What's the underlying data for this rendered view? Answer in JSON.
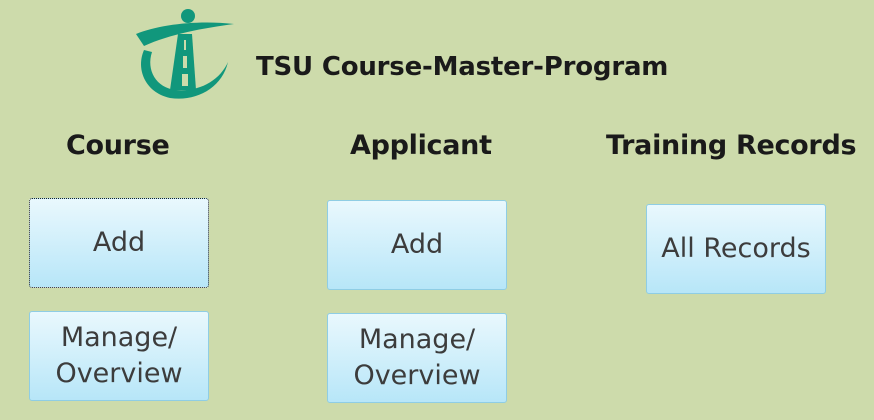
{
  "app": {
    "title": "TSU Course-Master-Program",
    "logo_icon": "tsu-logo-icon",
    "colors": {
      "background": "#cddbab",
      "logo_green": "#11977c",
      "button_top": "#e9f8fd",
      "button_bottom": "#b7e6f8",
      "button_border": "#8fcde4"
    }
  },
  "sections": {
    "course": {
      "heading": "Course",
      "add_label": "Add",
      "manage_label": "Manage/\nOverview"
    },
    "applicant": {
      "heading": "Applicant",
      "add_label": "Add",
      "manage_label": "Manage/\nOverview"
    },
    "training_records": {
      "heading": "Training Records",
      "all_records_label": "All Records"
    }
  }
}
